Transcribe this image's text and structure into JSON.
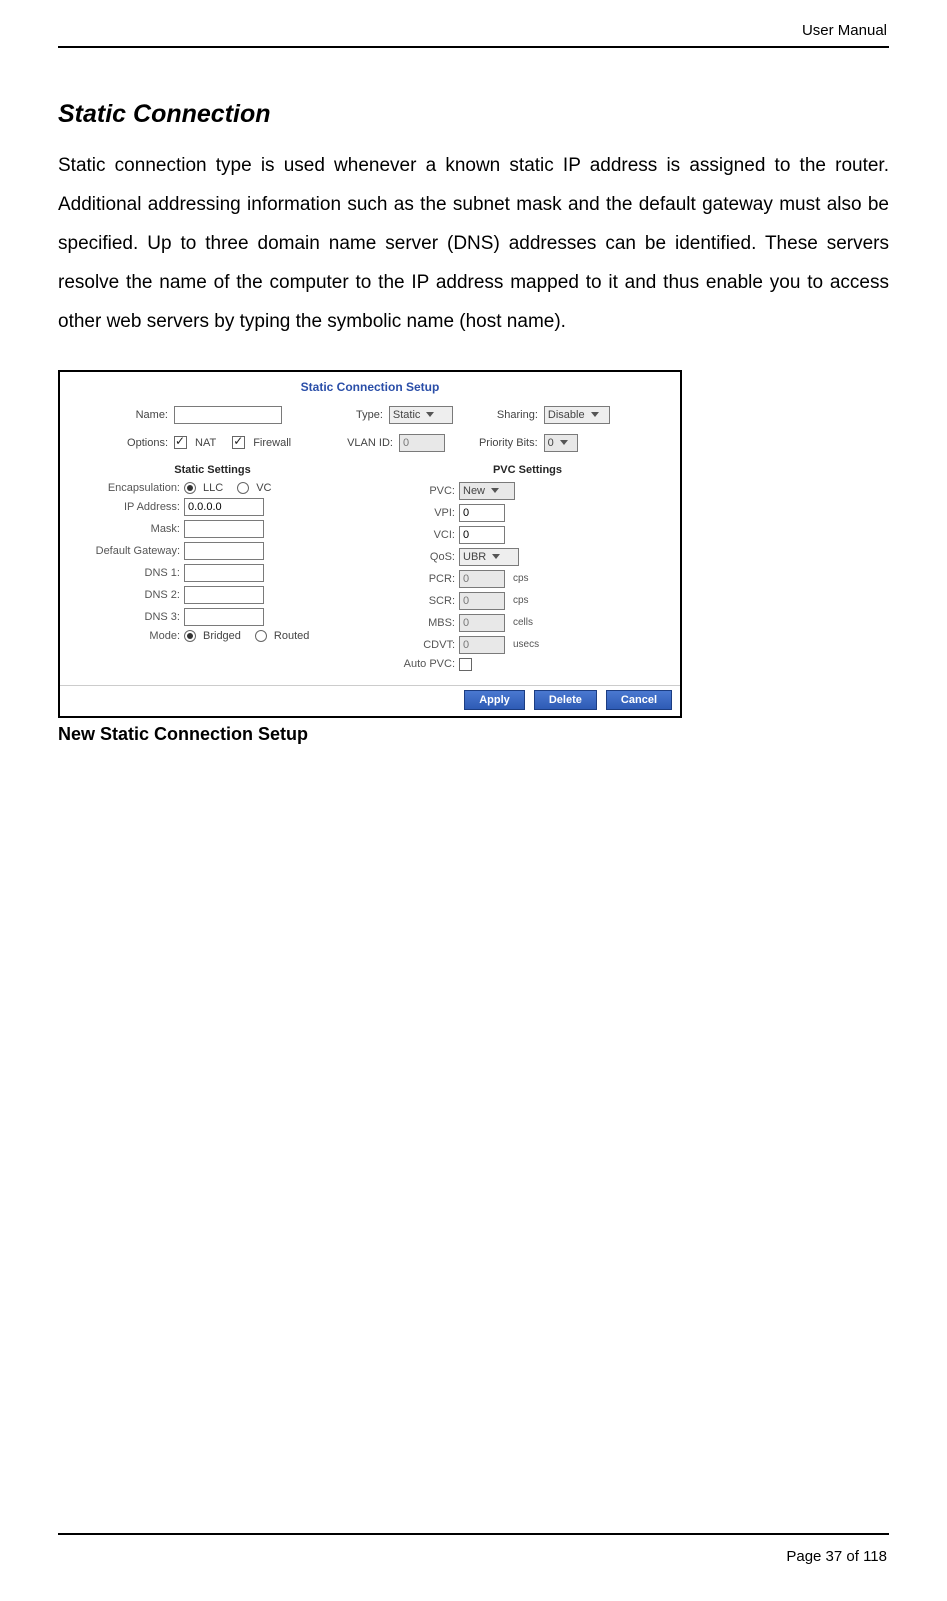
{
  "doc": {
    "header_right": "User Manual",
    "heading": "Static Connection",
    "body": "Static connection type is used whenever a known static IP address is assigned to the router. Additional addressing information such as the subnet mask and the default gateway must also be specified. Up to three domain name server (DNS) addresses can be identified. These servers resolve the name of the computer to the IP address mapped to it and thus enable you to access other web servers by typing the symbolic name (host name).",
    "caption": "New Static Connection Setup",
    "footer": "Page 37 of 118"
  },
  "ui": {
    "title": "Static Connection Setup",
    "name_label": "Name:",
    "name_value": "",
    "type_label": "Type:",
    "type_value": "Static",
    "sharing_label": "Sharing:",
    "sharing_value": "Disable",
    "options_label": "Options:",
    "nat_label": "NAT",
    "firewall_label": "Firewall",
    "vlan_label": "VLAN ID:",
    "vlan_value": "0",
    "priority_label": "Priority Bits:",
    "priority_value": "0",
    "static_section": "Static Settings",
    "encaps_label": "Encapsulation:",
    "encaps_llc": "LLC",
    "encaps_vc": "VC",
    "ip_label": "IP Address:",
    "ip_value": "0.0.0.0",
    "mask_label": "Mask:",
    "mask_value": "",
    "gw_label": "Default Gateway:",
    "gw_value": "",
    "dns1_label": "DNS 1:",
    "dns2_label": "DNS 2:",
    "dns3_label": "DNS 3:",
    "mode_label": "Mode:",
    "mode_bridged": "Bridged",
    "mode_routed": "Routed",
    "pvc_section": "PVC Settings",
    "pvc_label": "PVC:",
    "pvc_value": "New",
    "vpi_label": "VPI:",
    "vpi_value": "0",
    "vci_label": "VCI:",
    "vci_value": "0",
    "qos_label": "QoS:",
    "qos_value": "UBR",
    "pcr_label": "PCR:",
    "pcr_value": "0",
    "pcr_unit": "cps",
    "scr_label": "SCR:",
    "scr_value": "0",
    "scr_unit": "cps",
    "mbs_label": "MBS:",
    "mbs_value": "0",
    "mbs_unit": "cells",
    "cdvt_label": "CDVT:",
    "cdvt_value": "0",
    "cdvt_unit": "usecs",
    "autopvc_label": "Auto PVC:",
    "btn_apply": "Apply",
    "btn_delete": "Delete",
    "btn_cancel": "Cancel"
  }
}
